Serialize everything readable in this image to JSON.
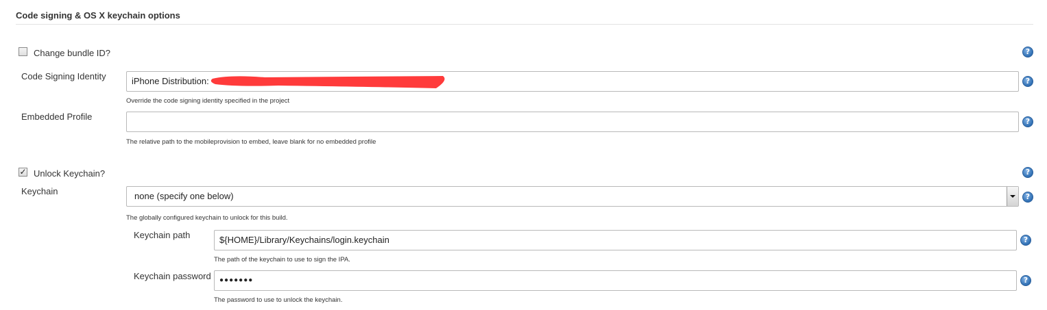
{
  "section": {
    "title": "Code signing & OS X keychain options"
  },
  "change_bundle": {
    "label": "Change bundle ID?",
    "checked": false
  },
  "code_signing_identity": {
    "label": "Code Signing Identity",
    "value": "iPhone Distribution:",
    "help": "Override the code signing identity specified in the project"
  },
  "embedded_profile": {
    "label": "Embedded Profile",
    "value": "",
    "help": "The relative path to the mobileprovision to embed, leave blank for no embedded profile"
  },
  "unlock_keychain": {
    "label": "Unlock Keychain?",
    "checked": true,
    "tick": "✓"
  },
  "keychain": {
    "label": "Keychain",
    "selected": "none (specify one below)",
    "help": "The globally configured keychain to unlock for this build."
  },
  "keychain_path": {
    "label": "Keychain path",
    "value": "${HOME}/Library/Keychains/login.keychain",
    "help": "The path of the keychain to use to sign the IPA."
  },
  "keychain_password": {
    "label": "Keychain password",
    "value": "●●●●●●●",
    "help": "The password to use to unlock the keychain."
  },
  "icons": {
    "help": "help-icon",
    "help_glyph": "?"
  },
  "colors": {
    "redaction": "#ff3b3b",
    "help_icon": "#2f6fb3"
  }
}
